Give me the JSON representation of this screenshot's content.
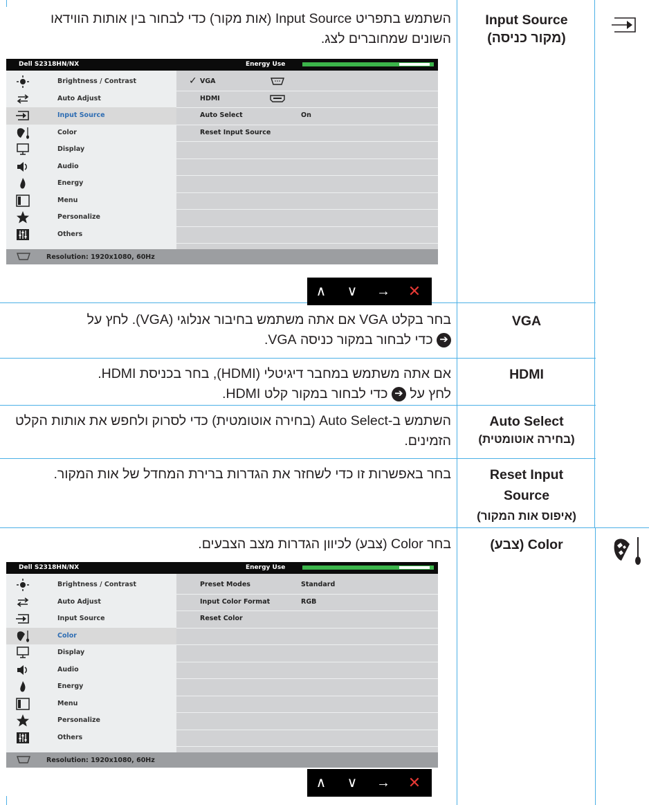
{
  "rows": {
    "input_source": {
      "label_en": "Input Source",
      "label_he": "(מקור כניסה)",
      "description": "השתמש בתפריט Input Source (אות מקור) כדי לבחור בין אותות הווידאו השונים שמחוברים לצג."
    },
    "vga": {
      "label": "VGA",
      "description_a": "בחר בקלט VGA אם אתה משתמש בחיבור אנלוגי (VGA). לחץ על",
      "description_b": "כדי לבחור במקור כניסה VGA."
    },
    "hdmi": {
      "label": "HDMI",
      "description_a": "אם אתה משתמש במחבר דיגיטלי (HDMI), בחר בכניסת HDMI.",
      "description_b_pre": "לחץ על",
      "description_b_post": "כדי לבחור במקור קלט HDMI."
    },
    "auto_select": {
      "label_en": "Auto Select",
      "label_he": "(בחירה אוטומטית)",
      "description": "השתמש ב-Auto Select (בחירה אוטומטית) כדי לסרוק ולחפש את אותות הקלט הזמינים."
    },
    "reset_input": {
      "label_line1": "Reset Input",
      "label_line2": "Source",
      "label_he": "(איפוס אות המקור)",
      "description": "בחר באפשרות זו כדי לשחזר את הגדרות ברירת המחדל של אות המקור."
    },
    "color": {
      "label": "Color (צבע)",
      "description": "בחר Color (צבע) לכיוון הגדרות מצב הצבעים."
    }
  },
  "osd": {
    "model": "Dell S2318HN/NX",
    "energy_use": "Energy Use",
    "resolution": "Resolution: 1920x1080, 60Hz",
    "menu": [
      "Brightness / Contrast",
      "Auto Adjust",
      "Input Source",
      "Color",
      "Display",
      "Audio",
      "Energy",
      "Menu",
      "Personalize",
      "Others"
    ],
    "input_panel": [
      {
        "name": "VGA",
        "value": "",
        "checked": true
      },
      {
        "name": "HDMI",
        "value": ""
      },
      {
        "name": "Auto Select",
        "value": "On"
      },
      {
        "name": "Reset Input Source",
        "value": ""
      }
    ],
    "color_panel": [
      {
        "name": "Preset Modes",
        "value": "Standard"
      },
      {
        "name": "Input Color Format",
        "value": "RGB"
      },
      {
        "name": "Reset Color",
        "value": ""
      }
    ],
    "nav": [
      "∧",
      "∨",
      "→",
      "✕"
    ]
  },
  "colors": {
    "border": "#4bb0e6",
    "selected_text": "#2e6db3",
    "energy_bar": "#3cb44b",
    "close": "#e53935"
  }
}
